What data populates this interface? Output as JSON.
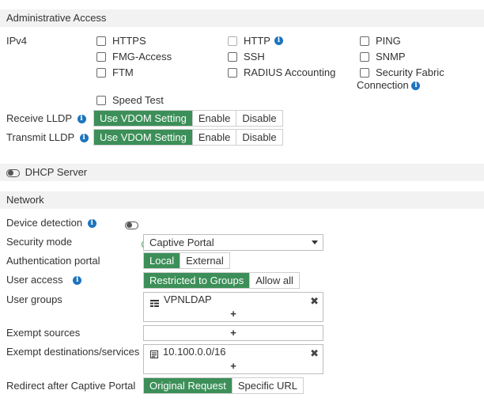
{
  "admin_access": {
    "header": "Administrative Access",
    "ipv4_label": "IPv4",
    "options": {
      "https": "HTTPS",
      "http": "HTTP",
      "ping": "PING",
      "fmg_access": "FMG-Access",
      "ssh": "SSH",
      "snmp": "SNMP",
      "ftm": "FTM",
      "radius_accounting": "RADIUS Accounting",
      "security_fabric_line1": "Security Fabric",
      "security_fabric_line2": "Connection",
      "speed_test": "Speed Test"
    },
    "receive_lldp": {
      "label": "Receive LLDP",
      "options": [
        "Use VDOM Setting",
        "Enable",
        "Disable"
      ],
      "selected": "Use VDOM Setting"
    },
    "transmit_lldp": {
      "label": "Transmit LLDP",
      "options": [
        "Use VDOM Setting",
        "Enable",
        "Disable"
      ],
      "selected": "Use VDOM Setting"
    }
  },
  "dhcp": {
    "label": "DHCP Server",
    "enabled": false
  },
  "network": {
    "header": "Network",
    "device_detection": {
      "label": "Device detection",
      "enabled": false
    },
    "security_mode": {
      "label": "Security mode",
      "enabled": true,
      "value": "Captive Portal"
    },
    "auth_portal": {
      "label": "Authentication portal",
      "options": [
        "Local",
        "External"
      ],
      "selected": "Local"
    },
    "user_access": {
      "label": "User access",
      "options": [
        "Restricted to Groups",
        "Allow all"
      ],
      "selected": "Restricted to Groups"
    },
    "user_groups": {
      "label": "User groups",
      "entries": [
        "VPNLDAP"
      ],
      "add_label": "+",
      "remove_label": "✖"
    },
    "exempt_sources": {
      "label": "Exempt sources",
      "add_label": "+"
    },
    "exempt_destinations": {
      "label": "Exempt destinations/services",
      "entries": [
        "10.100.0.0/16"
      ],
      "add_label": "+",
      "remove_label": "✖"
    },
    "redirect": {
      "label": "Redirect after Captive Portal",
      "options": [
        "Original Request",
        "Specific URL"
      ],
      "selected": "Original Request"
    }
  },
  "colors": {
    "accent_green": "#3c8f58",
    "info_blue": "#1e73be",
    "section_bg": "#f2f2f2"
  },
  "icons": [
    "info-icon",
    "toggle-icon",
    "user-group-icon",
    "address-icon",
    "remove-icon",
    "add-icon",
    "dropdown-caret-icon"
  ]
}
